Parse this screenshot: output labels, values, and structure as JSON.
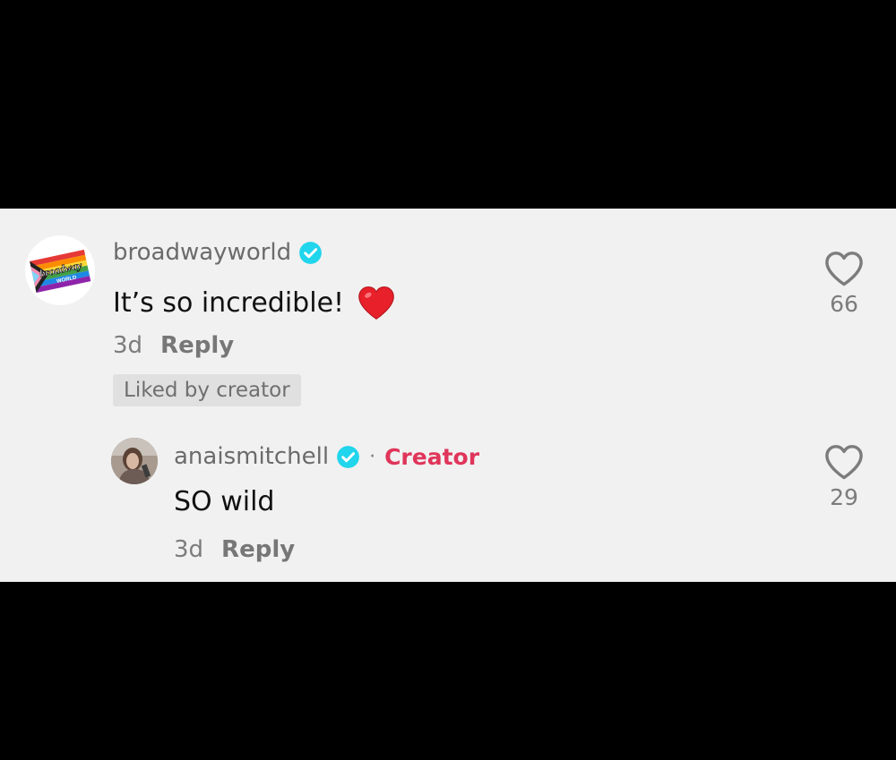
{
  "comments": [
    {
      "username": "broadwayworld",
      "avatar_text": "broadway",
      "avatar_subtext": "WORLD",
      "text": "It’s so incredible!",
      "emoji": "heart-emoji",
      "age": "3d",
      "reply_label": "Reply",
      "liked_badge": "Liked by creator",
      "like_count": "66"
    }
  ],
  "replies": [
    {
      "username": "anaismitchell",
      "creator_separator": "·",
      "creator_label": "Creator",
      "text": "SO wild",
      "age": "3d",
      "reply_label": "Reply",
      "like_count": "29"
    }
  ],
  "colors": {
    "panel_bg": "#f1f1f1",
    "verified": "#20d5ec",
    "creator": "#e0355a",
    "heart_emoji": "#e8202a"
  }
}
